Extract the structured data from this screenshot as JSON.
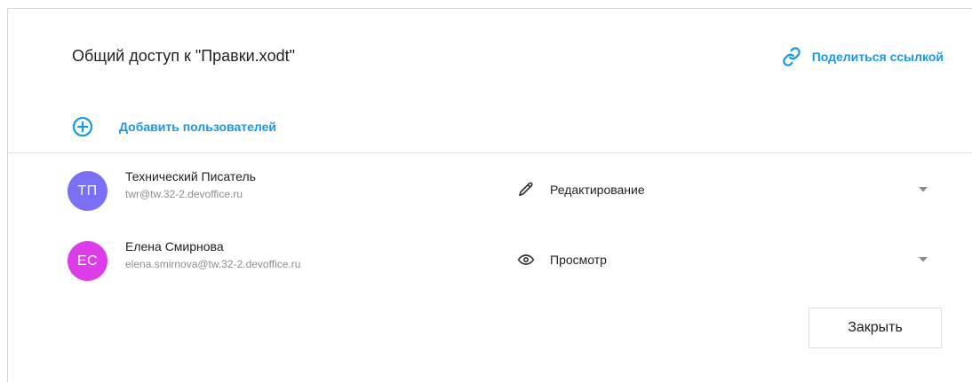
{
  "dialog": {
    "title": "Общий доступ к \"Правки.xodt\"",
    "share_link_label": "Поделиться ссылкой",
    "add_users_label": "Добавить пользователей",
    "close_label": "Закрыть"
  },
  "users": [
    {
      "initials": "ТП",
      "name": "Технический Писатель",
      "email": "twr@tw.32-2.devoffice.ru",
      "avatar_color": "#7b6ff5",
      "permission": "Редактирование",
      "permission_icon": "pencil-icon"
    },
    {
      "initials": "ЕС",
      "name": "Елена Смирнова",
      "email": "elena.smirnova@tw.32-2.devoffice.ru",
      "avatar_color": "#dd3de8",
      "permission": "Просмотр",
      "permission_icon": "eye-icon"
    }
  ],
  "colors": {
    "accent": "#1a98e6",
    "text": "#222222",
    "muted": "#8e8e8e"
  }
}
